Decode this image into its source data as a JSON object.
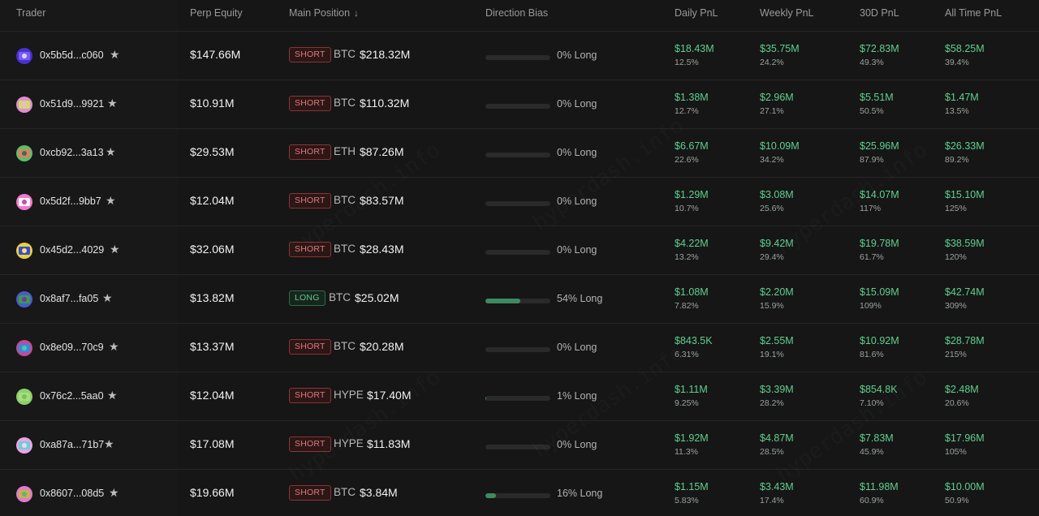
{
  "header": {
    "trader": "Trader",
    "perp_equity": "Perp Equity",
    "main_position": "Main Position",
    "sort_arrow": "↓",
    "direction_bias": "Direction Bias",
    "daily_pnl": "Daily PnL",
    "weekly_pnl": "Weekly PnL",
    "pnl_30d": "30D PnL",
    "all_time_pnl": "All Time PnL"
  },
  "watermark_text": "hyperdash.info",
  "star_glyph": "★",
  "colors": {
    "positive": "#5fd08e",
    "short_badge": "#e07a7a",
    "long_badge": "#72c08f",
    "bias_fill": "#3f8a60",
    "background": "#161616"
  },
  "rows": [
    {
      "address": "0x5b5d...c060",
      "equity": "$147.66M",
      "side": "SHORT",
      "coin": "BTC",
      "position_value": "$218.32M",
      "bias_long_fraction": 0,
      "bias": "0% Long",
      "daily": "$18.43M",
      "daily_pct": "12.5%",
      "weekly": "$35.75M",
      "weekly_pct": "24.2%",
      "d30": "$72.83M",
      "d30_pct": "49.3%",
      "all_time": "$58.25M",
      "all_time_pct": "39.4%",
      "avatar": [
        "#4a2fd1",
        "#7a5cf0",
        "#d6d0ff"
      ]
    },
    {
      "address": "0x51d9...9921",
      "equity": "$10.91M",
      "side": "SHORT",
      "coin": "BTC",
      "position_value": "$110.32M",
      "bias_long_fraction": 0,
      "bias": "0% Long",
      "daily": "$1.38M",
      "daily_pct": "12.7%",
      "weekly": "$2.96M",
      "weekly_pct": "27.1%",
      "d30": "$5.51M",
      "d30_pct": "50.5%",
      "all_time": "$1.47M",
      "all_time_pct": "13.5%",
      "avatar": [
        "#e58ad8",
        "#c8e05a",
        "#f3b0e8"
      ]
    },
    {
      "address": "0xcb92...3a13",
      "equity": "$29.53M",
      "side": "SHORT",
      "coin": "ETH",
      "position_value": "$87.26M",
      "bias_long_fraction": 0,
      "bias": "0% Long",
      "daily": "$6.67M",
      "daily_pct": "22.6%",
      "weekly": "$10.09M",
      "weekly_pct": "34.2%",
      "d30": "$25.96M",
      "d30_pct": "87.9%",
      "all_time": "$26.33M",
      "all_time_pct": "89.2%",
      "avatar": [
        "#5bbf6a",
        "#e87a6a",
        "#2f7a3a"
      ]
    },
    {
      "address": "0x5d2f...9bb7",
      "equity": "$12.04M",
      "side": "SHORT",
      "coin": "BTC",
      "position_value": "$83.57M",
      "bias_long_fraction": 0,
      "bias": "0% Long",
      "daily": "$1.29M",
      "daily_pct": "10.7%",
      "weekly": "$3.08M",
      "weekly_pct": "25.6%",
      "d30": "$14.07M",
      "d30_pct": "117%",
      "all_time": "$15.10M",
      "all_time_pct": "125%",
      "avatar": [
        "#f07ad0",
        "#f5f5f5",
        "#c050b0"
      ]
    },
    {
      "address": "0x45d2...4029",
      "equity": "$32.06M",
      "side": "SHORT",
      "coin": "BTC",
      "position_value": "$28.43M",
      "bias_long_fraction": 0,
      "bias": "0% Long",
      "daily": "$4.22M",
      "daily_pct": "13.2%",
      "weekly": "$9.42M",
      "weekly_pct": "29.4%",
      "d30": "$19.78M",
      "d30_pct": "61.7%",
      "all_time": "$38.59M",
      "all_time_pct": "120%",
      "avatar": [
        "#e8d040",
        "#3a4ad0",
        "#f5e070"
      ]
    },
    {
      "address": "0x8af7...fa05",
      "equity": "$13.82M",
      "side": "LONG",
      "coin": "BTC",
      "position_value": "$25.02M",
      "bias_long_fraction": 0.54,
      "bias": "54% Long",
      "daily": "$1.08M",
      "daily_pct": "7.82%",
      "weekly": "$2.20M",
      "weekly_pct": "15.9%",
      "d30": "$15.09M",
      "d30_pct": "109%",
      "all_time": "$42.74M",
      "all_time_pct": "309%",
      "avatar": [
        "#4a5acf",
        "#3f9a4a",
        "#6a3ab0"
      ]
    },
    {
      "address": "0x8e09...70c9",
      "equity": "$13.37M",
      "side": "SHORT",
      "coin": "BTC",
      "position_value": "$20.28M",
      "bias_long_fraction": 0,
      "bias": "0% Long",
      "daily": "$843.5K",
      "daily_pct": "6.31%",
      "weekly": "$2.55M",
      "weekly_pct": "19.1%",
      "d30": "$10.92M",
      "d30_pct": "81.6%",
      "all_time": "$28.78M",
      "all_time_pct": "215%",
      "avatar": [
        "#c04a9a",
        "#3a8ad0",
        "#50c0c0"
      ]
    },
    {
      "address": "0x76c2...5aa0",
      "equity": "$12.04M",
      "side": "SHORT",
      "coin": "HYPE",
      "position_value": "$17.40M",
      "bias_long_fraction": 0.01,
      "bias": "1% Long",
      "daily": "$1.11M",
      "daily_pct": "9.25%",
      "weekly": "$3.39M",
      "weekly_pct": "28.2%",
      "d30": "$854.8K",
      "d30_pct": "7.10%",
      "all_time": "$2.48M",
      "all_time_pct": "20.6%",
      "avatar": [
        "#8ed06a",
        "#a8dc80",
        "#7ac05a"
      ]
    },
    {
      "address": "0xa87a...71b7",
      "equity": "$17.08M",
      "side": "SHORT",
      "coin": "HYPE",
      "position_value": "$11.83M",
      "bias_long_fraction": 0,
      "bias": "0% Long",
      "daily": "$1.92M",
      "daily_pct": "11.3%",
      "weekly": "$4.87M",
      "weekly_pct": "28.5%",
      "d30": "$7.83M",
      "d30_pct": "45.9%",
      "all_time": "$17.96M",
      "all_time_pct": "105%",
      "avatar": [
        "#f0a0e8",
        "#6ad0d0",
        "#f5d0f0"
      ]
    },
    {
      "address": "0x8607...08d5",
      "equity": "$19.66M",
      "side": "SHORT",
      "coin": "BTC",
      "position_value": "$3.84M",
      "bias_long_fraction": 0.16,
      "bias": "16% Long",
      "daily": "$1.15M",
      "daily_pct": "5.83%",
      "weekly": "$3.43M",
      "weekly_pct": "17.4%",
      "d30": "$11.98M",
      "d30_pct": "60.9%",
      "all_time": "$10.00M",
      "all_time_pct": "50.9%",
      "avatar": [
        "#e07ad0",
        "#c8b050",
        "#6ab070"
      ]
    }
  ]
}
